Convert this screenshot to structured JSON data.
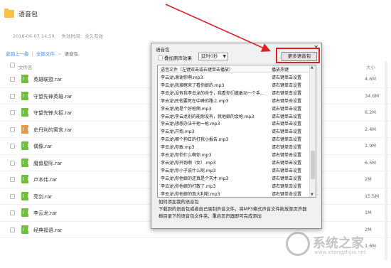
{
  "header": {
    "title": "语音包",
    "date": "2018-06-07 14:59",
    "expiry": "失效时间：永久有效"
  },
  "breadcrumb": {
    "back": "返回上一级",
    "sep": "|",
    "all": "全部文件",
    "arrow": ">",
    "current": "语音包"
  },
  "list": {
    "col_name": "文件名",
    "col_size": "大小",
    "files": [
      {
        "name": "英雄联盟.rar",
        "size": "4.6M",
        "color": "#6fbf3a"
      },
      {
        "name": "守望先锋英雄.rar",
        "size": "34.6M",
        "color": "#6fbf3a"
      },
      {
        "name": "守望先锋大招.rar",
        "size": "6.2M",
        "color": "#6fbf3a"
      },
      {
        "name": "史丹利的寓言.rar",
        "size": "2.4M",
        "color": "#e8974a"
      },
      {
        "name": "偶像.rar",
        "size": "1.9M",
        "color": "#6fbf3a"
      },
      {
        "name": "魔兽星际.rar",
        "size": "6.5M",
        "color": "#6fbf3a"
      },
      {
        "name": "卢本伟.rar",
        "size": "2M",
        "color": "#6fbf3a"
      },
      {
        "name": "亮剑.rar",
        "size": "15.5M",
        "color": "#6fbf3a"
      },
      {
        "name": "李云龙.rar",
        "size": "1M",
        "color": "#6fbf3a"
      },
      {
        "name": "经典福语.rar",
        "size": "2M",
        "color": "#6fbf3a"
      }
    ],
    "last_size": "1.6M"
  },
  "dialog": {
    "title": "语音包",
    "close": "✕",
    "overlay_label": "叠加原声效果",
    "delay_value": "延时0秒",
    "more_button": "更多语音包",
    "table_head_file": "语音文件（左键双击或右键单击播放）",
    "table_head_hotkey": "播放热键",
    "rows": [
      {
        "file": "李云龙\\谢谢你啊.mp3",
        "key": "请右键单击设置"
      },
      {
        "file": "李云龙\\我接瞎来了看你娘的.mp3",
        "key": "请右键单击设置"
      },
      {
        "file": "李云龙\\没有我李云龙的命令，我看你们谁敢动一个手...",
        "key": "请右键单击设置"
      },
      {
        "file": "李云龙\\民他要死在中峰的路上.mp3",
        "key": "请右键单击设置"
      },
      {
        "file": "李云龙\\他是个好枪啊.mp3",
        "key": "请右键单击设置"
      },
      {
        "file": "李云龙\\李云龙别的能耐没有，就他娘的会枪.mp3",
        "key": "请右键单击设置"
      },
      {
        "file": "李云龙\\想想办法干他一枪.mp3",
        "key": "请右键单击设置"
      },
      {
        "file": "李云龙\\开炮.mp3",
        "key": "请右键单击设置"
      },
      {
        "file": "李云龙\\哪个狗日的打我小报告.mp3",
        "key": "请右键单击设置"
      },
      {
        "file": "李云龙\\你敢.mp3",
        "key": "请右键单击设置"
      },
      {
        "file": "李云龙\\你怕什么啊你.mp3",
        "key": "请右键单击设置"
      },
      {
        "file": "李云龙\\你开炮啊（女）.mp3",
        "key": "请右键单击设置"
      },
      {
        "file": "李云龙\\你小子说什么呢.mp3",
        "key": "请右键单击设置"
      },
      {
        "file": "李云龙\\你他娘的还真是个天才.mp3",
        "key": "请右键单击设置"
      },
      {
        "file": "李云龙\\你他娘的打散了.mp3",
        "key": "请右键单击设置"
      },
      {
        "file": "李云龙\\你他娘的真大利啦.mp3",
        "key": "请右键单击设置"
      }
    ],
    "instructions": [
      "如何添加我的语音包",
      "下载到的语音包或者自己录制声音文件，将MP3格式声音文件拖放至页声器",
      "根目录下的语音包文件夹，重启页声器即可完成添加"
    ]
  },
  "watermark": {
    "text": "系统之家",
    "url": "www.xitongzhijia.net"
  },
  "colors": {
    "link": "#3b8cff",
    "folder": "#f7c244",
    "highlight": "#e02020"
  }
}
